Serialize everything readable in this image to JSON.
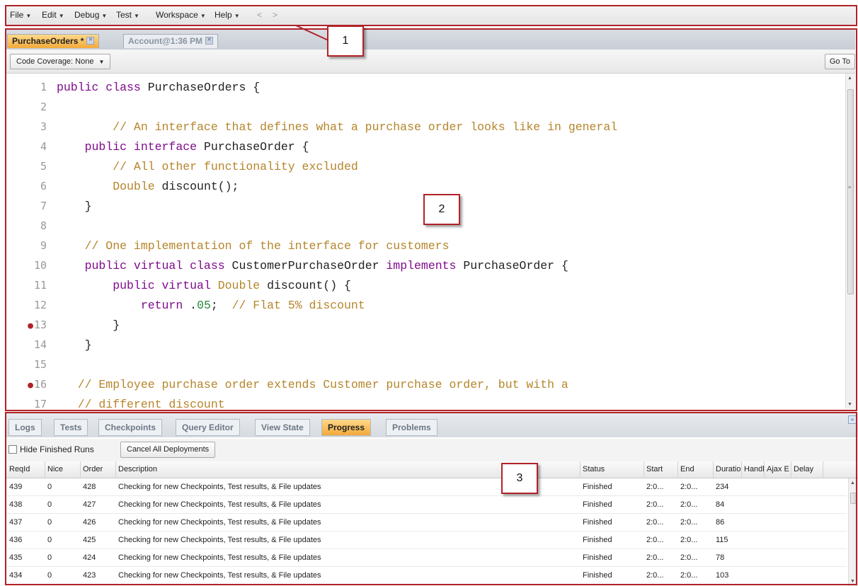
{
  "menu": {
    "items": [
      {
        "label": "File"
      },
      {
        "label": "Edit"
      },
      {
        "label": "Debug"
      },
      {
        "label": "Test"
      },
      {
        "label": "Workspace"
      },
      {
        "label": "Help"
      }
    ],
    "back_label": "<",
    "forward_label": ">"
  },
  "callouts": [
    "1",
    "2",
    "3"
  ],
  "editor_tabs": [
    {
      "label": "PurchaseOrders *",
      "active": true
    },
    {
      "label": "Account@1:36 PM",
      "active": false
    }
  ],
  "editor_toolbar": {
    "coverage_label": "Code Coverage: None",
    "goto_label": "Go To"
  },
  "code_lines": [
    {
      "num": "1",
      "breakpoint": false,
      "tokens": [
        {
          "t": "kw",
          "v": "public class"
        },
        {
          "t": "tx",
          "v": " PurchaseOrders {"
        }
      ]
    },
    {
      "num": "2",
      "breakpoint": false,
      "tokens": []
    },
    {
      "num": "3",
      "breakpoint": false,
      "tokens": [
        {
          "t": "cm",
          "v": "        // An interface that defines what a purchase order looks like in general"
        }
      ]
    },
    {
      "num": "4",
      "breakpoint": false,
      "tokens": [
        {
          "t": "tx",
          "v": "    "
        },
        {
          "t": "kw",
          "v": "public interface"
        },
        {
          "t": "tx",
          "v": " PurchaseOrder {"
        }
      ]
    },
    {
      "num": "5",
      "breakpoint": false,
      "tokens": [
        {
          "t": "cm",
          "v": "        // All other functionality excluded"
        }
      ]
    },
    {
      "num": "6",
      "breakpoint": false,
      "tokens": [
        {
          "t": "tx",
          "v": "        "
        },
        {
          "t": "cm",
          "v": "Double"
        },
        {
          "t": "tx",
          "v": " discount();"
        }
      ]
    },
    {
      "num": "7",
      "breakpoint": false,
      "tokens": [
        {
          "t": "tx",
          "v": "    }"
        }
      ]
    },
    {
      "num": "8",
      "breakpoint": false,
      "tokens": []
    },
    {
      "num": "9",
      "breakpoint": false,
      "tokens": [
        {
          "t": "cm",
          "v": "    // One implementation of the interface for customers"
        }
      ]
    },
    {
      "num": "10",
      "breakpoint": false,
      "tokens": [
        {
          "t": "tx",
          "v": "    "
        },
        {
          "t": "kw",
          "v": "public virtual class"
        },
        {
          "t": "tx",
          "v": " CustomerPurchaseOrder "
        },
        {
          "t": "kw",
          "v": "implements"
        },
        {
          "t": "tx",
          "v": " PurchaseOrder {"
        }
      ]
    },
    {
      "num": "11",
      "breakpoint": false,
      "tokens": [
        {
          "t": "tx",
          "v": "        "
        },
        {
          "t": "kw",
          "v": "public virtual"
        },
        {
          "t": "tx",
          "v": " "
        },
        {
          "t": "cm",
          "v": "Double"
        },
        {
          "t": "tx",
          "v": " discount() {"
        }
      ]
    },
    {
      "num": "12",
      "breakpoint": false,
      "tokens": [
        {
          "t": "tx",
          "v": "            "
        },
        {
          "t": "kw",
          "v": "return"
        },
        {
          "t": "tx",
          "v": " ."
        },
        {
          "t": "num",
          "v": "05"
        },
        {
          "t": "tx",
          "v": ";  "
        },
        {
          "t": "cm",
          "v": "// Flat 5% discount"
        }
      ]
    },
    {
      "num": "13",
      "breakpoint": true,
      "tokens": [
        {
          "t": "tx",
          "v": "        }"
        }
      ]
    },
    {
      "num": "14",
      "breakpoint": false,
      "tokens": [
        {
          "t": "tx",
          "v": "    }"
        }
      ]
    },
    {
      "num": "15",
      "breakpoint": false,
      "tokens": []
    },
    {
      "num": "16",
      "breakpoint": true,
      "tokens": [
        {
          "t": "cm",
          "v": "   // Employee purchase order extends Customer purchase order, but with a"
        }
      ]
    },
    {
      "num": "17",
      "breakpoint": false,
      "tokens": [
        {
          "t": "cm",
          "v": "   // different discount"
        }
      ]
    }
  ],
  "bottom_tabs": [
    {
      "label": "Logs",
      "active": false
    },
    {
      "label": "Tests",
      "active": false
    },
    {
      "label": "Checkpoints",
      "active": false
    },
    {
      "label": "Query Editor",
      "active": false
    },
    {
      "label": "View State",
      "active": false
    },
    {
      "label": "Progress",
      "active": true
    },
    {
      "label": "Problems",
      "active": false
    }
  ],
  "panel_toolbar": {
    "hide_finished_label": "Hide Finished Runs",
    "hide_finished_checked": false,
    "cancel_all_label": "Cancel All Deployments"
  },
  "grid": {
    "columns": [
      "ReqId",
      "Nice",
      "Order",
      "Description",
      "Status",
      "Start",
      "End",
      "Duratio",
      "Handle",
      "Ajax E",
      "Delay"
    ],
    "rows": [
      [
        "439",
        "0",
        "428",
        "Checking for new Checkpoints, Test results, & File updates",
        "Finished",
        "2:0...",
        "2:0...",
        "234",
        "",
        "",
        ""
      ],
      [
        "438",
        "0",
        "427",
        "Checking for new Checkpoints, Test results, & File updates",
        "Finished",
        "2:0...",
        "2:0...",
        "84",
        "",
        "",
        ""
      ],
      [
        "437",
        "0",
        "426",
        "Checking for new Checkpoints, Test results, & File updates",
        "Finished",
        "2:0...",
        "2:0...",
        "86",
        "",
        "",
        ""
      ],
      [
        "436",
        "0",
        "425",
        "Checking for new Checkpoints, Test results, & File updates",
        "Finished",
        "2:0...",
        "2:0...",
        "115",
        "",
        "",
        ""
      ],
      [
        "435",
        "0",
        "424",
        "Checking for new Checkpoints, Test results, & File updates",
        "Finished",
        "2:0...",
        "2:0...",
        "78",
        "",
        "",
        ""
      ],
      [
        "434",
        "0",
        "423",
        "Checking for new Checkpoints, Test results, & File updates",
        "Finished",
        "2:0...",
        "2:0...",
        "103",
        "",
        "",
        ""
      ]
    ]
  },
  "colors": {
    "annotation": "#b02228",
    "keyword": "#7f0b8c",
    "comment": "#b5852a",
    "number": "#2a8a3a",
    "active_tab": "#f2a93b"
  }
}
